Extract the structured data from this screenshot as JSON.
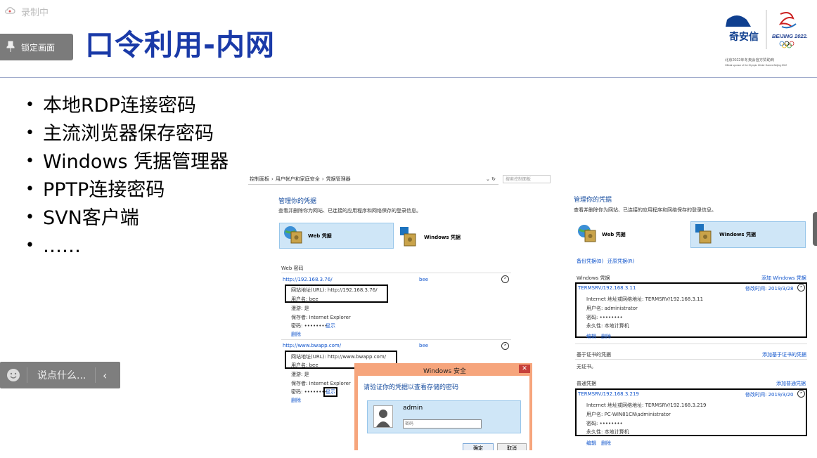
{
  "recording": {
    "label": "录制中"
  },
  "lock": {
    "label": "锁定画面"
  },
  "slide": {
    "title": "口令利用-内网",
    "bullets": [
      "本地RDP连接密码",
      "主流浏览器保存密码",
      "Windows 凭据管理器",
      "PPTP连接密码",
      "SVN客户端",
      "……"
    ]
  },
  "logo": {
    "brand": "奇安信",
    "beijing": "BEIJING 2022.",
    "sponsor_cn": "北京2022年冬奥会官方赞助商",
    "sponsor_en": "Official sponsor of the Olympic Winter Games Beijing 2022"
  },
  "chat": {
    "placeholder": "说点什么..."
  },
  "cm": {
    "breadcrumb": [
      "控制面板",
      "用户帐户和家庭安全",
      "凭据管理器"
    ],
    "search_placeholder": "搜索控制面板",
    "heading": "管理你的凭据",
    "desc": "查看并删除你为网站、已连接的应用程序和网络保存的登录信息。",
    "web_label": "Web 凭据",
    "win_label": "Windows 凭据",
    "section": "Web 密码",
    "entries": [
      {
        "url": "http://192.168.3.76/",
        "user": "bee",
        "url_line": "网站地址(URL): http://192.168.3.76/",
        "user_line": "用户名: bee",
        "roam": "漫游: 是",
        "saved": "保存者: Internet Explorer",
        "pwd": "密码: ••••••••",
        "show": "显示",
        "del": "删除"
      },
      {
        "url": "http://www.bwapp.com/",
        "user": "bee",
        "url_line": "网站地址(URL): http://www.bwapp.com/",
        "user_line": "用户名: bee",
        "roam": "漫游: 是",
        "saved": "保存者: Internet Explorer",
        "pwd": "密码: ••••••••",
        "show": "显示",
        "del": "删除"
      }
    ]
  },
  "dlg": {
    "title": "Windows 安全",
    "prompt": "请验证你的凭据以查看存储的密码",
    "user": "admin",
    "pwd_placeholder": "密码",
    "ok": "确定",
    "cancel": "取消"
  },
  "right": {
    "heading": "管理你的凭据",
    "desc": "查看并删除你为网站、已连接的应用程序和网络保存的登录信息。",
    "web_label": "Web 凭据",
    "win_label": "Windows 凭据",
    "backup": "备份凭据(B)",
    "restore": "还原凭据(R)",
    "win_section": "Windows 凭据",
    "add_win": "添加 Windows 凭据",
    "cred1": {
      "name": "TERMSRV/192.168.3.11",
      "mod": "修改时间: 2019/3/28",
      "addr": "Internet 地址或网络地址: TERMSRV/192.168.3.11",
      "user": "用户名: administrator",
      "pwd": "密码: ••••••••",
      "persist": "永久性: 本地计算机",
      "edit": "编辑",
      "del": "删除"
    },
    "cert_section": "基于证书的凭据",
    "add_cert": "添加基于证书的凭据",
    "no_cert": "无证书。",
    "gen_section": "普通凭据",
    "add_gen": "添加普通凭据",
    "cred2": {
      "name": "TERMSRV/192.168.3.219",
      "mod": "修改时间: 2019/3/20",
      "addr": "Internet 地址或网络地址: TERMSRV/192.168.3.219",
      "user": "用户名: PC-WIN81CN\\administrator",
      "pwd": "密码: ••••••••",
      "persist": "永久性: 本地计算机",
      "edit": "编辑",
      "del": "删除"
    }
  }
}
